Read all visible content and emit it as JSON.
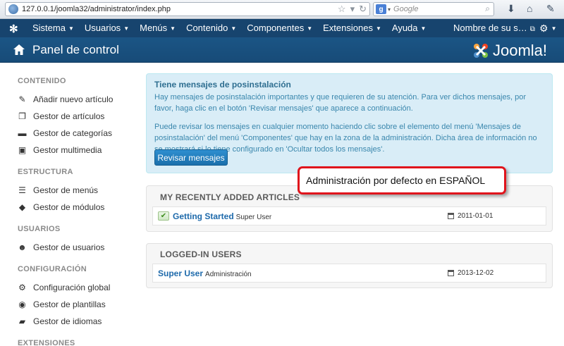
{
  "browser": {
    "url": "127.0.0.1/joomla32/administrator/index.php",
    "search_placeholder": "Google",
    "search_engine_icon": "google-icon"
  },
  "topnav": {
    "items": [
      {
        "label": "Sistema"
      },
      {
        "label": "Usuarios"
      },
      {
        "label": "Menús"
      },
      {
        "label": "Contenido"
      },
      {
        "label": "Componentes"
      },
      {
        "label": "Extensiones"
      },
      {
        "label": "Ayuda"
      }
    ],
    "site_name": "Nombre de su s…",
    "bg_color": "#17446e"
  },
  "header": {
    "title": "Panel de control",
    "brand": "Joomla!"
  },
  "sidebar": {
    "sections": [
      {
        "heading": "CONTENIDO",
        "items": [
          {
            "label": "Añadir nuevo artículo",
            "icon": "pencil-icon"
          },
          {
            "label": "Gestor de artículos",
            "icon": "stack-icon"
          },
          {
            "label": "Gestor de categorías",
            "icon": "folder-icon"
          },
          {
            "label": "Gestor multimedia",
            "icon": "image-icon"
          }
        ]
      },
      {
        "heading": "ESTRUCTURA",
        "items": [
          {
            "label": "Gestor de menús",
            "icon": "list-icon"
          },
          {
            "label": "Gestor de módulos",
            "icon": "cube-icon"
          }
        ]
      },
      {
        "heading": "USUARIOS",
        "items": [
          {
            "label": "Gestor de usuarios",
            "icon": "users-icon"
          }
        ]
      },
      {
        "heading": "CONFIGURACIÓN",
        "items": [
          {
            "label": "Configuración global",
            "icon": "gear-icon"
          },
          {
            "label": "Gestor de plantillas",
            "icon": "eye-icon"
          },
          {
            "label": "Gestor de idiomas",
            "icon": "comments-icon"
          }
        ]
      },
      {
        "heading": "EXTENSIONES",
        "items": []
      }
    ]
  },
  "alert": {
    "title": "Tiene mensajes de posinstalación",
    "paragraph1": "Hay mensajes de posinstalación importantes y que requieren de su atención. Para ver dichos mensajes, por favor, haga clic en el botón 'Revisar mensajes' que aparece a continuación.",
    "paragraph2": "Puede revisar los mensajes en cualquier momento haciendo clic sobre el elemento del menú 'Mensajes de posinstalación' del menú 'Componentes' que hay en la zona de la administración. Dicha área de información no se mostrará si lo tiene configurado en 'Ocultar todos los mensajes'.",
    "button": "Revisar mensajes"
  },
  "recent_articles": {
    "title": "MY RECENTLY ADDED ARTICLES",
    "rows": [
      {
        "title": "Getting Started",
        "author": "Super User",
        "date": "2011-01-01"
      }
    ]
  },
  "logged_users": {
    "title": "LOGGED-IN USERS",
    "rows": [
      {
        "name": "Super User",
        "area": "Administración",
        "date": "2013-12-02"
      }
    ]
  },
  "callout": {
    "text": "Administración por defecto en ESPAÑOL",
    "border_color": "#e0141c"
  }
}
